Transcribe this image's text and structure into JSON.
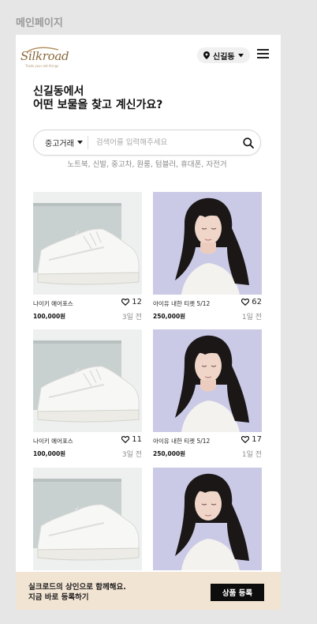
{
  "frame_label": "메인페이지",
  "header": {
    "logo_text": "Silkroad",
    "logo_tagline": "Trade your old things",
    "location": "신길동"
  },
  "headline": {
    "line1": "신길동에서",
    "line2": "어떤 보물을 찾고 계신가요?"
  },
  "search": {
    "category": "중고거래",
    "placeholder": "검색어를 입력해주세요",
    "keywords": "노트북, 신발, 중고차, 원룸, 텀블러, 휴대폰, 자전거"
  },
  "products": [
    {
      "image": "sneaker-photo",
      "title": "나이키 에어포스",
      "likes": "12",
      "price": "100,000원",
      "time": "3일 전"
    },
    {
      "image": "person-photo",
      "title": "아이유 내한 티켓 5/12",
      "likes": "62",
      "price": "250,000원",
      "time": "1일 전"
    },
    {
      "image": "sneaker-photo",
      "title": "나이키 에어포스",
      "likes": "11",
      "price": "100,000원",
      "time": "3일 전"
    },
    {
      "image": "person-photo",
      "title": "아이유 내한 티켓 5/12",
      "likes": "17",
      "price": "250,000원",
      "time": "1일 전"
    },
    {
      "image": "sneaker-photo"
    },
    {
      "image": "person-photo"
    }
  ],
  "banner": {
    "line1": "실크로드의 상인으로 함께해요.",
    "line2": "지금 바로 등록하기",
    "button": "상품 등록",
    "background": "#f2e4d3"
  },
  "colors": {
    "accent": "#8a6a3c",
    "button": "#0d0d0d"
  }
}
